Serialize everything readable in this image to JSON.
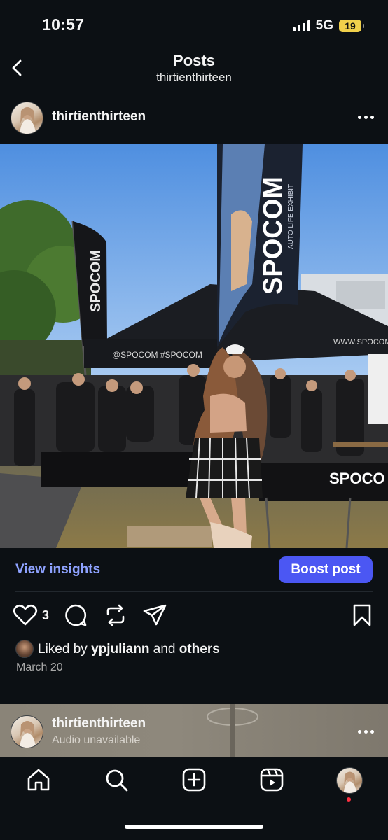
{
  "status_bar": {
    "time": "10:57",
    "network": "5G",
    "battery": "19"
  },
  "header": {
    "title": "Posts",
    "subtitle": "thirtienthirteen"
  },
  "post": {
    "username": "thirtienthirteen",
    "banner_text": "SPOCOM",
    "banner_sub": "AUTO LIFE EXHIBIT",
    "tent_text": "@SPOCOM  #SPOCOM",
    "tent_right_text": "WWW.SPOCOMUSA.C",
    "view_insights": "View insights",
    "boost_post": "Boost post",
    "like_count": "3",
    "liked_by_prefix": "Liked by",
    "liked_by_user": "ypjuliann",
    "liked_by_and": "and",
    "liked_by_others": "others",
    "date": "March 20"
  },
  "next_post": {
    "username": "thirtienthirteen",
    "audio": "Audio unavailable"
  },
  "nav": [
    "home-icon",
    "search-icon",
    "create-icon",
    "reels-icon",
    "profile-avatar"
  ],
  "colors": {
    "background": "#0c1014",
    "accent": "#4b57f3",
    "insights_link": "#8ea2ff",
    "notification_dot": "#ff3040"
  }
}
